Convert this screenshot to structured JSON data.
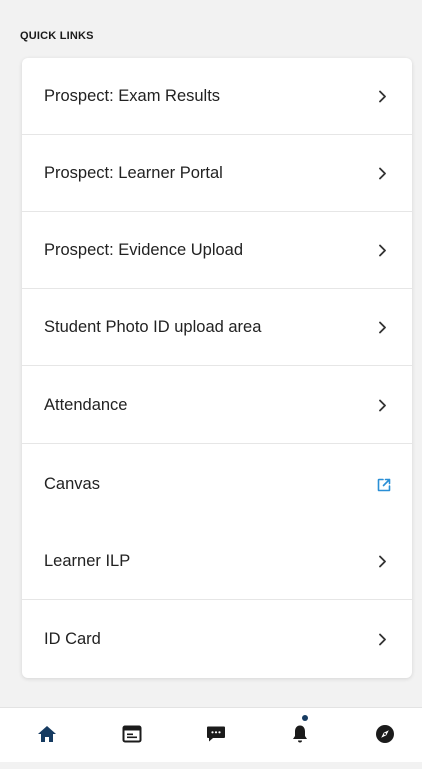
{
  "section": {
    "title": "QUICK LINKS"
  },
  "links": [
    {
      "label": "Prospect: Exam Results",
      "icon": "chevron-right-icon"
    },
    {
      "label": "Prospect: Learner Portal",
      "icon": "chevron-right-icon"
    },
    {
      "label": "Prospect: Evidence Upload",
      "icon": "chevron-right-icon"
    },
    {
      "label": "Student Photo ID upload area",
      "icon": "chevron-right-icon"
    },
    {
      "label": "Attendance",
      "icon": "chevron-right-icon"
    },
    {
      "label": "Canvas",
      "icon": "external-link-icon"
    },
    {
      "label": "Learner ILP",
      "icon": "chevron-right-icon"
    },
    {
      "label": "ID Card",
      "icon": "chevron-right-icon"
    }
  ],
  "bottom_nav": {
    "items": [
      {
        "icon": "home-icon",
        "active": true
      },
      {
        "icon": "calendar-icon",
        "active": false
      },
      {
        "icon": "chat-icon",
        "active": false
      },
      {
        "icon": "bell-icon",
        "active": false,
        "has_notification": true
      },
      {
        "icon": "compass-icon",
        "active": false
      }
    ]
  },
  "colors": {
    "background": "#f2f2f2",
    "card": "#ffffff",
    "text": "#222222",
    "chevron": "#333333",
    "external_link": "#2a8fd6",
    "nav_active": "#163b61",
    "nav_icon": "#1b1b1b",
    "notification_dot": "#163b61"
  }
}
